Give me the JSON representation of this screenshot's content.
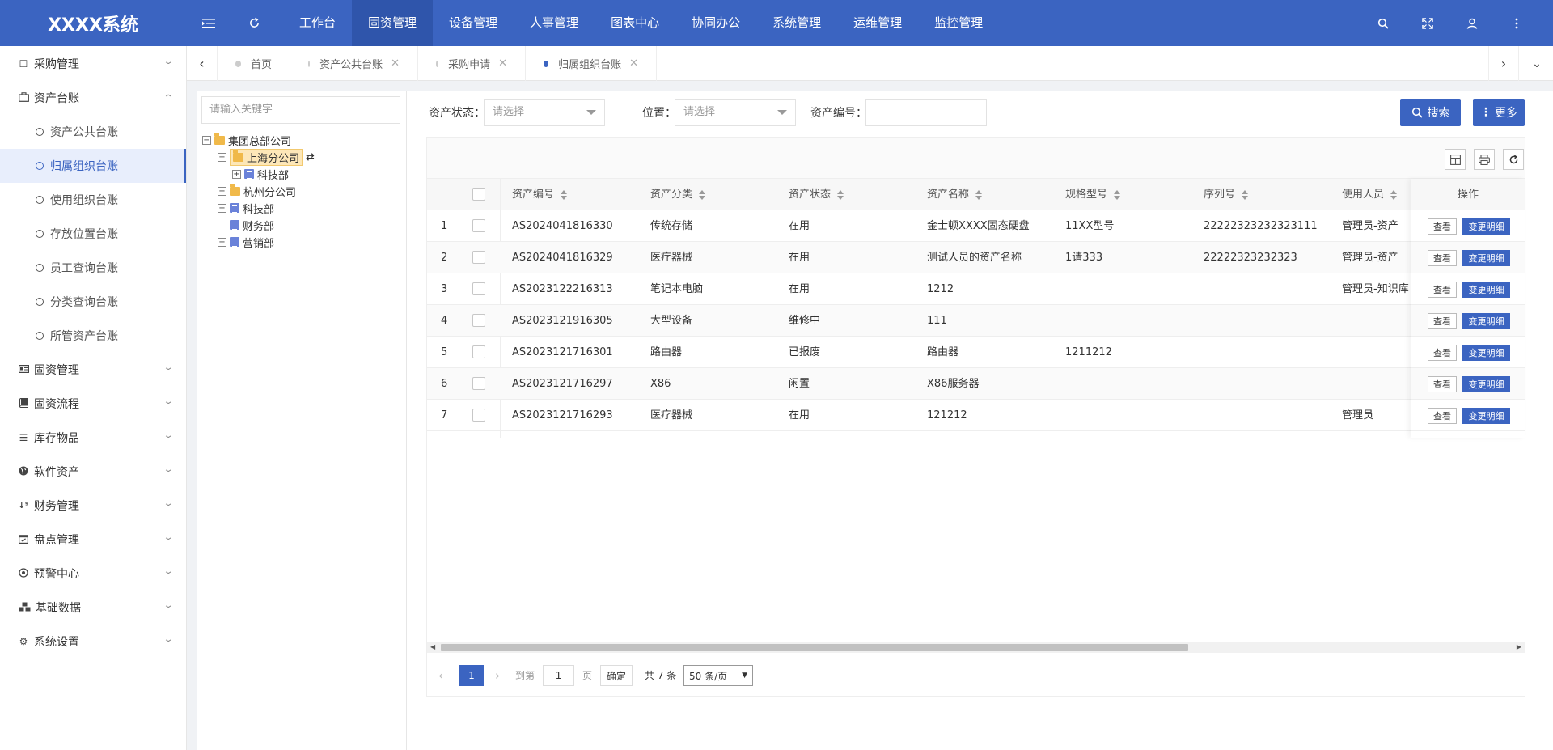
{
  "app": {
    "title": "XXXX系统"
  },
  "header": {
    "nav": [
      "工作台",
      "固资管理",
      "设备管理",
      "人事管理",
      "图表中心",
      "协同办公",
      "系统管理",
      "运维管理",
      "监控管理"
    ],
    "active_nav": "固资管理",
    "icons": [
      "menu-toggle-icon",
      "refresh-icon",
      "search-icon",
      "fullscreen-icon",
      "user-icon",
      "more-vertical-icon"
    ]
  },
  "sidebar": {
    "items": [
      {
        "label": "采购管理",
        "icon": "square-icon",
        "expanded": false
      },
      {
        "label": "资产台账",
        "icon": "briefcase-icon",
        "expanded": true,
        "children": [
          "资产公共台账",
          "归属组织台账",
          "使用组织台账",
          "存放位置台账",
          "员工查询台账",
          "分类查询台账",
          "所管资产台账"
        ],
        "active_child": "归属组织台账"
      },
      {
        "label": "固资管理",
        "icon": "id-card-icon",
        "expanded": false
      },
      {
        "label": "固资流程",
        "icon": "book-icon",
        "expanded": false
      },
      {
        "label": "库存物品",
        "icon": "list-icon",
        "expanded": false
      },
      {
        "label": "软件资产",
        "icon": "globe-icon",
        "expanded": false
      },
      {
        "label": "财务管理",
        "icon": "sort-numeric-icon",
        "expanded": false
      },
      {
        "label": "盘点管理",
        "icon": "calendar-check-icon",
        "expanded": false
      },
      {
        "label": "预警中心",
        "icon": "target-icon",
        "expanded": false
      },
      {
        "label": "基础数据",
        "icon": "cubes-icon",
        "expanded": false
      },
      {
        "label": "系统设置",
        "icon": "gear-icon",
        "expanded": false
      }
    ]
  },
  "tabs": {
    "items": [
      {
        "label": "首页",
        "closable": false
      },
      {
        "label": "资产公共台账",
        "closable": true
      },
      {
        "label": "采购申请",
        "closable": true
      },
      {
        "label": "归属组织台账",
        "closable": true
      }
    ],
    "active": "归属组织台账"
  },
  "tree": {
    "search_placeholder": "请输入关键字",
    "nodes": [
      {
        "label": "集团总部公司",
        "type": "company",
        "level": 0,
        "toggle": "−"
      },
      {
        "label": "上海分公司",
        "type": "company",
        "level": 1,
        "toggle": "−",
        "selected": true
      },
      {
        "label": "科技部",
        "type": "dept",
        "level": 2,
        "toggle": "+"
      },
      {
        "label": "杭州分公司",
        "type": "company",
        "level": 1,
        "toggle": "+"
      },
      {
        "label": "科技部",
        "type": "dept",
        "level": 1,
        "toggle": "+"
      },
      {
        "label": "财务部",
        "type": "dept",
        "level": 1,
        "toggle": ""
      },
      {
        "label": "营销部",
        "type": "dept",
        "level": 1,
        "toggle": "+"
      }
    ]
  },
  "filters": {
    "status_label": "资产状态：",
    "status_placeholder": "请选择",
    "location_label": "位置：",
    "location_placeholder": "请选择",
    "code_label": "资产编号：",
    "code_value": "",
    "search_button": "搜索",
    "more_button": "更多"
  },
  "table": {
    "columns": [
      "资产编号",
      "资产分类",
      "资产状态",
      "资产名称",
      "规格型号",
      "序列号",
      "使用人员",
      "操作"
    ],
    "rows": [
      {
        "no": "1",
        "code": "AS2024041816330",
        "category": "传统存储",
        "status": "在用",
        "name": "金士顿XXXX固态硬盘",
        "model": "11XX型号",
        "serial": "22222323232323111",
        "user": "管理员-资产"
      },
      {
        "no": "2",
        "code": "AS2024041816329",
        "category": "医疗器械",
        "status": "在用",
        "name": "测试人员的资产名称",
        "model": "1请333",
        "serial": "22222323232323",
        "user": "管理员-资产"
      },
      {
        "no": "3",
        "code": "AS2023122216313",
        "category": "笔记本电脑",
        "status": "在用",
        "name": "1212",
        "model": "",
        "serial": "",
        "user": "管理员-知识库"
      },
      {
        "no": "4",
        "code": "AS2023121916305",
        "category": "大型设备",
        "status": "维修中",
        "name": "111",
        "model": "",
        "serial": "",
        "user": ""
      },
      {
        "no": "5",
        "code": "AS2023121716301",
        "category": "路由器",
        "status": "已报废",
        "name": "路由器",
        "model": "1211212",
        "serial": "",
        "user": ""
      },
      {
        "no": "6",
        "code": "AS2023121716297",
        "category": "X86",
        "status": "闲置",
        "name": "X86服务器",
        "model": "",
        "serial": "",
        "user": ""
      },
      {
        "no": "7",
        "code": "AS2023121716293",
        "category": "医疗器械",
        "status": "在用",
        "name": "121212",
        "model": "",
        "serial": "",
        "user": "管理员"
      }
    ],
    "view_button": "查看",
    "detail_button": "变更明细"
  },
  "pagination": {
    "current_page": "1",
    "goto_label": "到第",
    "goto_value": "1",
    "page_unit": "页",
    "confirm": "确定",
    "total": "共 7 条",
    "page_size": "50 条/页"
  },
  "colors": {
    "primary": "#3b64c1",
    "header_active": "#2f55ab"
  }
}
